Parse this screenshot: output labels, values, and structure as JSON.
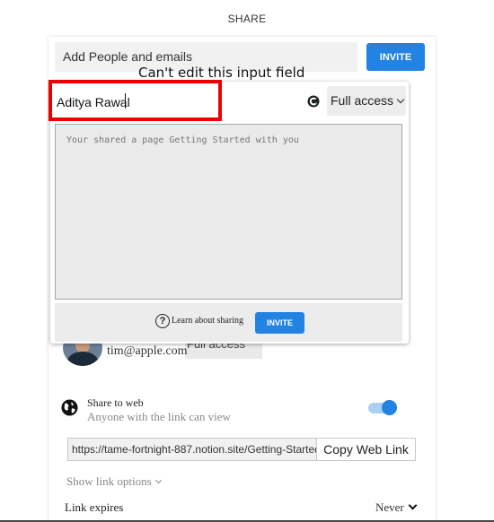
{
  "header": {
    "title": "SHARE"
  },
  "add_people": {
    "placeholder": "Add People and emails",
    "invite_label": "INVITE"
  },
  "annotation": {
    "text": "Can't edit this input field",
    "highlight_color": "#ee0000"
  },
  "invite_dialog": {
    "name_value": "Aditya Rawal",
    "access": "Full access",
    "message_placeholder": "Your shared a page Getting Started with you",
    "learn_label": "Learn about sharing",
    "invite_label": "INVITE"
  },
  "member": {
    "email": "tim@apple.com",
    "access": "Full access"
  },
  "web_share": {
    "title": "Share to web",
    "subtitle": "Anyone with the link can view",
    "enabled": true,
    "link": "https://tame-fortnight-887.notion.site/Getting-Started",
    "copy_label": "Copy Web Link",
    "show_options": "Show link options",
    "expires_label": "Link expires",
    "expires_value": "Never"
  },
  "colors": {
    "accent": "#2383e2",
    "toggle_track": "#a9cff6"
  }
}
